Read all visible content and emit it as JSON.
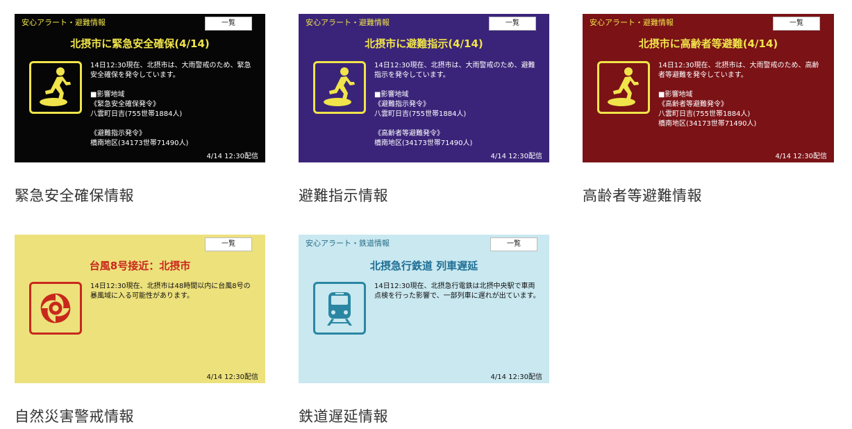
{
  "cards": [
    {
      "header": "安心アラート・避難情報",
      "button": "一覧",
      "title": "北摂市に緊急安全確保(4/14)",
      "body": "14日12:30現在、北摂市は、大雨警戒のため、緊急\n安全確保を発令しています。\n\n■影響地域\n《緊急安全確保発令》\n八雲町日吉(755世帯1884人)\n\n《避難指示発令》\n橋南地区(34173世帯71490人)",
      "footer": "4/14 12:30配信",
      "caption": "緊急安全確保情報",
      "icon": "evacuation-run-icon",
      "bg": "#060606"
    },
    {
      "header": "安心アラート・避難情報",
      "button": "一覧",
      "title": "北摂市に避難指示(4/14)",
      "body": "14日12:30現在、北摂市は、大雨警戒のため、避難\n指示を発令しています。\n\n■影響地域\n《避難指示発令》\n八雲町日吉(755世帯1884人)\n\n《高齢者等避難発令》\n橋南地区(34173世帯71490人)",
      "footer": "4/14 12:30配信",
      "caption": "避難指示情報",
      "icon": "evacuation-run-icon",
      "bg": "#3a2479"
    },
    {
      "header": "安心アラート・避難情報",
      "button": "一覧",
      "title": "北摂市に高齢者等避難(4/14)",
      "body": "14日12:30現在、北摂市は、大雨警戒のため、高齢\n者等避難を発令しています。\n\n■影響地域\n《高齢者等避難発令》\n八雲町日吉(755世帯1884人)\n橋南地区(34173世帯71490人)",
      "footer": "4/14 12:30配信",
      "caption": "高齢者等避難情報",
      "icon": "evacuation-run-icon",
      "bg": "#7a1216"
    },
    {
      "header": "",
      "button": "一覧",
      "title": "台風8号接近：北摂市",
      "body": "14日12:30現在、北摂市は48時間以内に台風8号の\n暴風域に入る可能性があります。",
      "footer": "4/14 12:30配信",
      "caption": "自然災害警戒情報",
      "icon": "typhoon-icon",
      "bg": "#ede17c"
    },
    {
      "header": "安心アラート・鉄道情報",
      "button": "一覧",
      "title": "北摂急行鉄道 列車遅延",
      "body": "14日12:30現在、北摂急行電鉄は北摂中央駅で車両\n点検を行った影響で、一部列車に遅れが出ています。",
      "footer": "4/14 12:30配信",
      "caption": "鉄道遅延情報",
      "icon": "train-icon",
      "bg": "#c9e8f0"
    }
  ]
}
